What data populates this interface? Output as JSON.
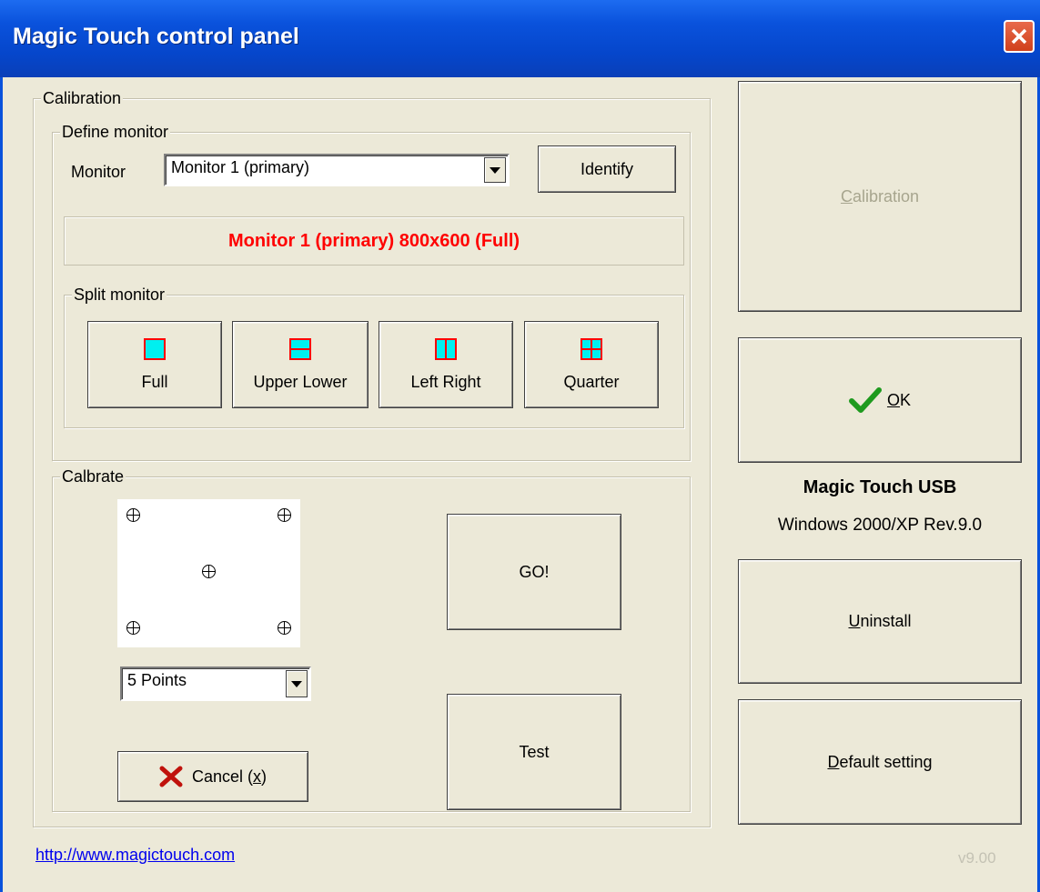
{
  "window": {
    "title": "Magic Touch control panel"
  },
  "calibration_group": {
    "legend": "Calibration",
    "define_monitor": {
      "legend": "Define monitor",
      "monitor_label": "Monitor",
      "monitor_value": "Monitor 1 (primary)",
      "identify_button": "Identify",
      "status": "Monitor 1 (primary) 800x600 (Full)"
    },
    "split_monitor": {
      "legend": "Split monitor",
      "buttons": [
        {
          "label": "Full",
          "icon": "split-full-icon"
        },
        {
          "label": "Upper Lower",
          "icon": "split-upper-lower-icon"
        },
        {
          "label": "Left Right",
          "icon": "split-left-right-icon"
        },
        {
          "label": "Quarter",
          "icon": "split-quarter-icon"
        }
      ]
    },
    "calibrate": {
      "legend": "Calbrate",
      "points_value": "5 Points",
      "go_button": "GO!",
      "test_button": "Test",
      "cancel_button": {
        "prefix": "Cancel (",
        "hotkey": "x",
        "suffix": ")"
      }
    }
  },
  "right_panel": {
    "calibration_button": {
      "hotkey": "C",
      "rest": "alibration"
    },
    "ok_button": {
      "hotkey": "O",
      "rest": "K"
    },
    "product_name": "Magic Touch USB",
    "product_platform": "Windows 2000/XP Rev.9.0",
    "uninstall_button": {
      "hotkey": "U",
      "rest": "ninstall"
    },
    "default_button": {
      "hotkey": "D",
      "rest": "efault setting"
    }
  },
  "footer": {
    "link": "http://www.magictouch.com",
    "version": "v9.00"
  },
  "colors": {
    "status_text": "#ff0000",
    "split_icon_fill": "#00f0f0",
    "split_icon_border": "#ff0000",
    "link": "#0000ee",
    "version": "#c4c2b4"
  }
}
